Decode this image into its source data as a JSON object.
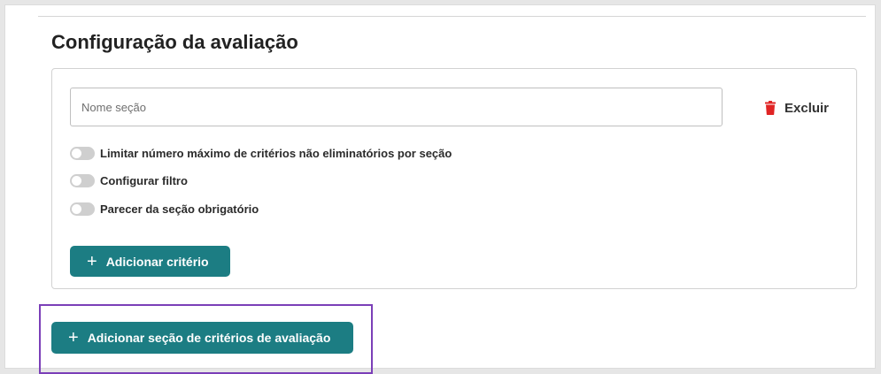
{
  "page": {
    "title": "Configuração da avaliação"
  },
  "section": {
    "name_placeholder": "Nome seção",
    "name_value": "",
    "delete_label": "Excluir",
    "toggles": [
      {
        "label": "Limitar número máximo de critérios não eliminatórios por seção",
        "on": false
      },
      {
        "label": "Configurar filtro",
        "on": false
      },
      {
        "label": "Parecer da seção obrigatório",
        "on": false
      }
    ],
    "add_criterion_label": "Adicionar critério"
  },
  "add_section_label": "Adicionar seção de critérios de avaliação",
  "colors": {
    "primary": "#1c7d83",
    "delete_icon": "#e02424",
    "highlight": "#7b3fb8",
    "toggle_off": "#cfcfcf"
  },
  "icons": {
    "delete": "trash-icon",
    "add": "plus-icon",
    "toggle": "toggle-switch"
  }
}
